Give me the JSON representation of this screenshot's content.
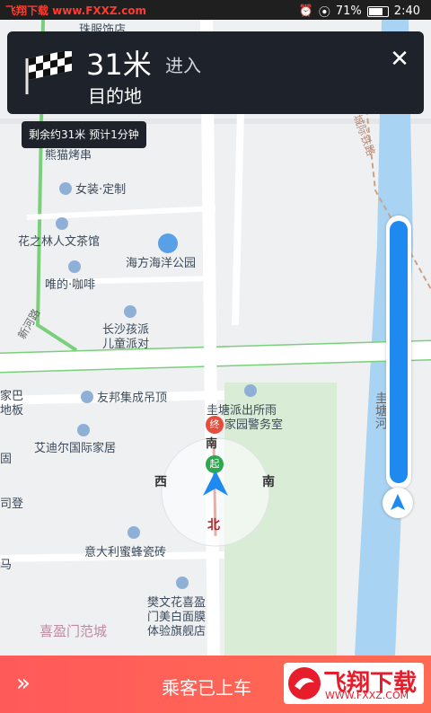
{
  "status_bar": {
    "watermark": "飞翔下载 www.FXXZ.com",
    "battery": "71%",
    "time": "2:40"
  },
  "nav": {
    "distance": "31米",
    "action": "进入",
    "destination": "目的地",
    "remaining": "剩余约31米  预计1分钟"
  },
  "map": {
    "pois": [
      {
        "label": "珠服饰店"
      },
      {
        "label": "熊猫烤串"
      },
      {
        "label": "女装·定制"
      },
      {
        "label": "花之林人文茶馆"
      },
      {
        "label": "海方海洋公园"
      },
      {
        "label": "唯的·咖啡"
      },
      {
        "label": "长沙孩派"
      },
      {
        "label": "儿童派对"
      },
      {
        "label": "友邦集成吊顶"
      },
      {
        "label": "圭塘派出所雨"
      },
      {
        "label": "家园警务室"
      },
      {
        "label": "艾迪尔国际家居"
      },
      {
        "label": "意大利蜜蜂瓷砖"
      },
      {
        "label": "樊文花喜盈"
      },
      {
        "label": "门美白面膜"
      },
      {
        "label": "体验旗舰店"
      },
      {
        "label": "家巴"
      },
      {
        "label": "地板"
      },
      {
        "label": "固"
      },
      {
        "label": "司登"
      },
      {
        "label": "马"
      }
    ],
    "area_label": "喜盈门范城",
    "roads": [
      "新河路",
      "城际铁路",
      "圭塘河"
    ],
    "compass": {
      "n": "北",
      "e": "南",
      "s": "北",
      "w": "西"
    },
    "markers": {
      "end": "终",
      "start": "起",
      "road_mid": "南"
    }
  },
  "bottom_bar": {
    "status": "乘客已上车",
    "watermark_brand": "飞翔下载",
    "watermark_url": "WWW.FXXZ.COM"
  },
  "progress": {
    "value": 0.98
  }
}
